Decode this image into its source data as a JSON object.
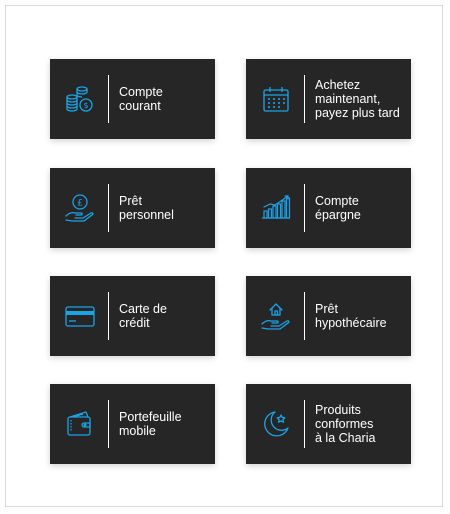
{
  "colors": {
    "tile_background": "#262626",
    "icon_accent": "#1aa3e8",
    "text": "#ffffff"
  },
  "tiles": [
    {
      "icon": "coins-icon",
      "lines": [
        "Compte",
        "courant"
      ]
    },
    {
      "icon": "calendar-icon",
      "lines": [
        "Achetez",
        "maintenant,",
        "payez plus tard"
      ]
    },
    {
      "icon": "hand-pound-coin-icon",
      "lines": [
        "Prêt",
        "personnel"
      ]
    },
    {
      "icon": "bar-chart-savings-icon",
      "lines": [
        "Compte",
        "épargne"
      ]
    },
    {
      "icon": "credit-card-icon",
      "lines": [
        "Carte de",
        "crédit"
      ]
    },
    {
      "icon": "hand-house-icon",
      "lines": [
        "Prêt",
        "hypothécaire"
      ]
    },
    {
      "icon": "wallet-icon",
      "lines": [
        "Portefeuille",
        "mobile"
      ]
    },
    {
      "icon": "crescent-star-icon",
      "lines": [
        "Produits",
        "conformes",
        "à la Charia"
      ]
    }
  ]
}
